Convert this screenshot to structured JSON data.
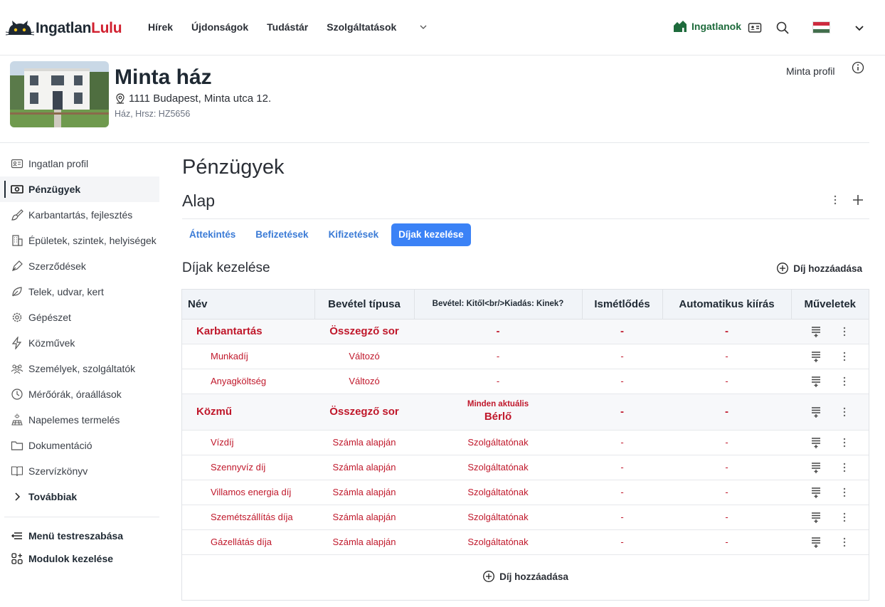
{
  "brand": {
    "part1": "Ingatlan",
    "part2": "Lulu"
  },
  "nav": {
    "items": [
      "Hírek",
      "Újdonságok",
      "Tudástár",
      "Szolgáltatások"
    ],
    "properties_label": "Ingatlanok"
  },
  "property": {
    "title": "Minta ház",
    "address": "1111 Budapest, Minta utca 12.",
    "subtitle": "Ház, Hrsz: HZ5656",
    "profile_label": "Minta profil"
  },
  "sidebar": {
    "items": [
      {
        "label": "Ingatlan profil",
        "icon": "id-card-icon"
      },
      {
        "label": "Pénzügyek",
        "icon": "banknote-icon"
      },
      {
        "label": "Karbantartás, fejlesztés",
        "icon": "brush-icon"
      },
      {
        "label": "Épületek, szintek, helyiségek",
        "icon": "building-icon"
      },
      {
        "label": "Szerződések",
        "icon": "pen-icon"
      },
      {
        "label": "Telek, udvar, kert",
        "icon": "leaf-icon"
      },
      {
        "label": "Gépészet",
        "icon": "gear-icon"
      },
      {
        "label": "Közművek",
        "icon": "bolt-icon"
      },
      {
        "label": "Személyek, szolgáltatók",
        "icon": "people-icon"
      },
      {
        "label": "Mérőórák, óraállások",
        "icon": "clock-icon"
      },
      {
        "label": "Napelemes termelés",
        "icon": "solar-icon"
      },
      {
        "label": "Dokumentáció",
        "icon": "folder-icon"
      },
      {
        "label": "Szervízkönyv",
        "icon": "book-icon"
      },
      {
        "label": "Továbbiak",
        "icon": "chevron-right-icon"
      }
    ],
    "bottom": [
      {
        "label": "Menü testreszabása",
        "icon": "menu-icon"
      },
      {
        "label": "Modulok kezelése",
        "icon": "modules-icon"
      }
    ]
  },
  "main": {
    "title": "Pénzügyek",
    "subtitle": "Alap",
    "tabs": [
      "Áttekintés",
      "Befizetések",
      "Kifizetések",
      "Díjak kezelése"
    ],
    "active_tab": "Díjak kezelése",
    "section_title": "Díjak kezelése",
    "add_fee_label": "Díj hozzáadása"
  },
  "table": {
    "headers": [
      "Név",
      "Bevétel típusa",
      "Bevétel: Kitől<br/>Kiadás: Kinek?",
      "Ismétlődés",
      "Automatikus kiírás",
      "Műveletek"
    ],
    "rows": [
      {
        "group": true,
        "name": "Karbantartás",
        "type": "Összegző sor",
        "party": "-",
        "repeat": "-",
        "auto": "-"
      },
      {
        "group": false,
        "name": "Munkadíj",
        "type": "Változó",
        "party": "-",
        "repeat": "-",
        "auto": "-"
      },
      {
        "group": false,
        "name": "Anyagköltség",
        "type": "Változó",
        "party": "-",
        "repeat": "-",
        "auto": "-"
      },
      {
        "group": true,
        "tall": true,
        "name": "Közmű",
        "type": "Összegző sor",
        "party_top": "Minden aktuális",
        "party": "Bérlő",
        "repeat": "-",
        "auto": "-"
      },
      {
        "group": false,
        "name": "Vízdíj",
        "type": "Számla alapján",
        "party": "Szolgáltatónak",
        "repeat": "-",
        "auto": "-"
      },
      {
        "group": false,
        "name": "Szennyvíz díj",
        "type": "Számla alapján",
        "party": "Szolgáltatónak",
        "repeat": "-",
        "auto": "-"
      },
      {
        "group": false,
        "name": "Villamos energia díj",
        "type": "Számla alapján",
        "party": "Szolgáltatónak",
        "repeat": "-",
        "auto": "-"
      },
      {
        "group": false,
        "name": "Szemétszállítás díja",
        "type": "Számla alapján",
        "party": "Szolgáltatónak",
        "repeat": "-",
        "auto": "-"
      },
      {
        "group": false,
        "name": "Gázellátás díja",
        "type": "Számla alapján",
        "party": "Szolgáltatónak",
        "repeat": "-",
        "auto": "-"
      }
    ]
  },
  "colors": {
    "accent": "#3b82f6",
    "brand_red": "#d1202f",
    "row_text": "#c0182b",
    "green": "#1e6b3c"
  }
}
